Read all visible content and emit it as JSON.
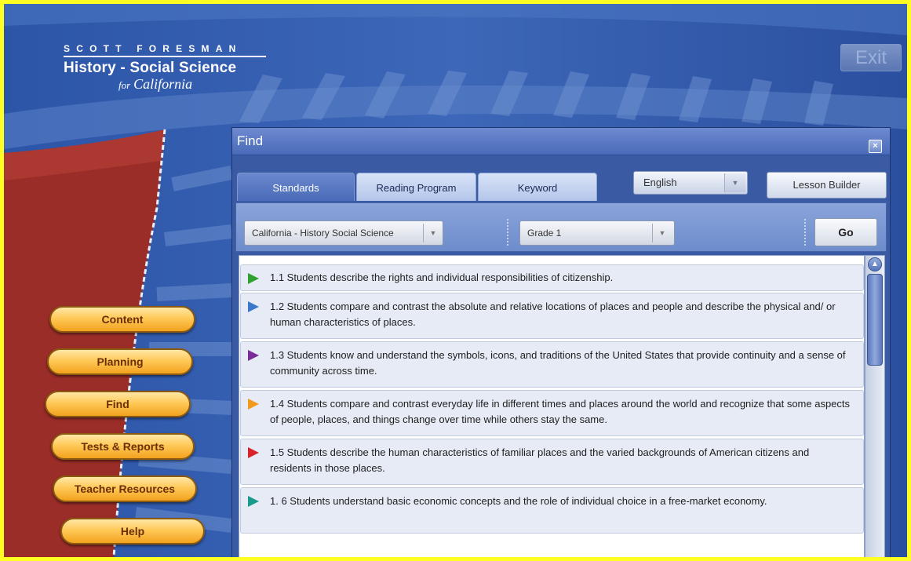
{
  "header": {
    "brand": "SCOTT FORESMAN",
    "product": "History - Social Science",
    "subtitle_for": "for",
    "subtitle_place": "California",
    "exit_label": "Exit"
  },
  "nav": {
    "items": [
      {
        "label": "Content"
      },
      {
        "label": "Planning"
      },
      {
        "label": "Find"
      },
      {
        "label": "Tests & Reports"
      },
      {
        "label": "Teacher Resources"
      },
      {
        "label": "Help"
      }
    ]
  },
  "panel": {
    "title": "Find",
    "close_icon": "close-icon",
    "tabs": [
      {
        "label": "Standards",
        "active": true
      },
      {
        "label": "Reading Program",
        "active": false
      },
      {
        "label": "Keyword",
        "active": false
      }
    ],
    "language": {
      "value": "English"
    },
    "lesson_builder_label": "Lesson Builder",
    "filters": {
      "curriculum": "California - History Social Science",
      "grade": "Grade 1",
      "go_label": "Go"
    },
    "standards": [
      {
        "text": "1.1 Students describe the rights and individual responsibilities of citizenship.",
        "color": "#2ea12e"
      },
      {
        "text": "1.2 Students compare and contrast the absolute and relative locations of places and people and describe the physical and/ or human characteristics of places.",
        "color": "#3a78cc"
      },
      {
        "text": "1.3 Students know and understand the symbols, icons, and traditions of the United States that provide continuity and a sense of community across time.",
        "color": "#7b2c99"
      },
      {
        "text": "1.4 Students compare and contrast everyday life in different times and places around the world and recognize that some aspects of people, places, and things change over time while others stay the same.",
        "color": "#f29a1c"
      },
      {
        "text": "1.5 Students describe the human characteristics of familiar places and the varied backgrounds of American citizens and residents in those places.",
        "color": "#d8222a"
      },
      {
        "text": "1. 6 Students understand basic economic concepts and the role of individual choice in a free-market economy.",
        "color": "#1a9a8a"
      }
    ]
  },
  "colors": {
    "frame": "#ffff22",
    "background": "#2a4a96",
    "nav_button": "#ffc958"
  }
}
